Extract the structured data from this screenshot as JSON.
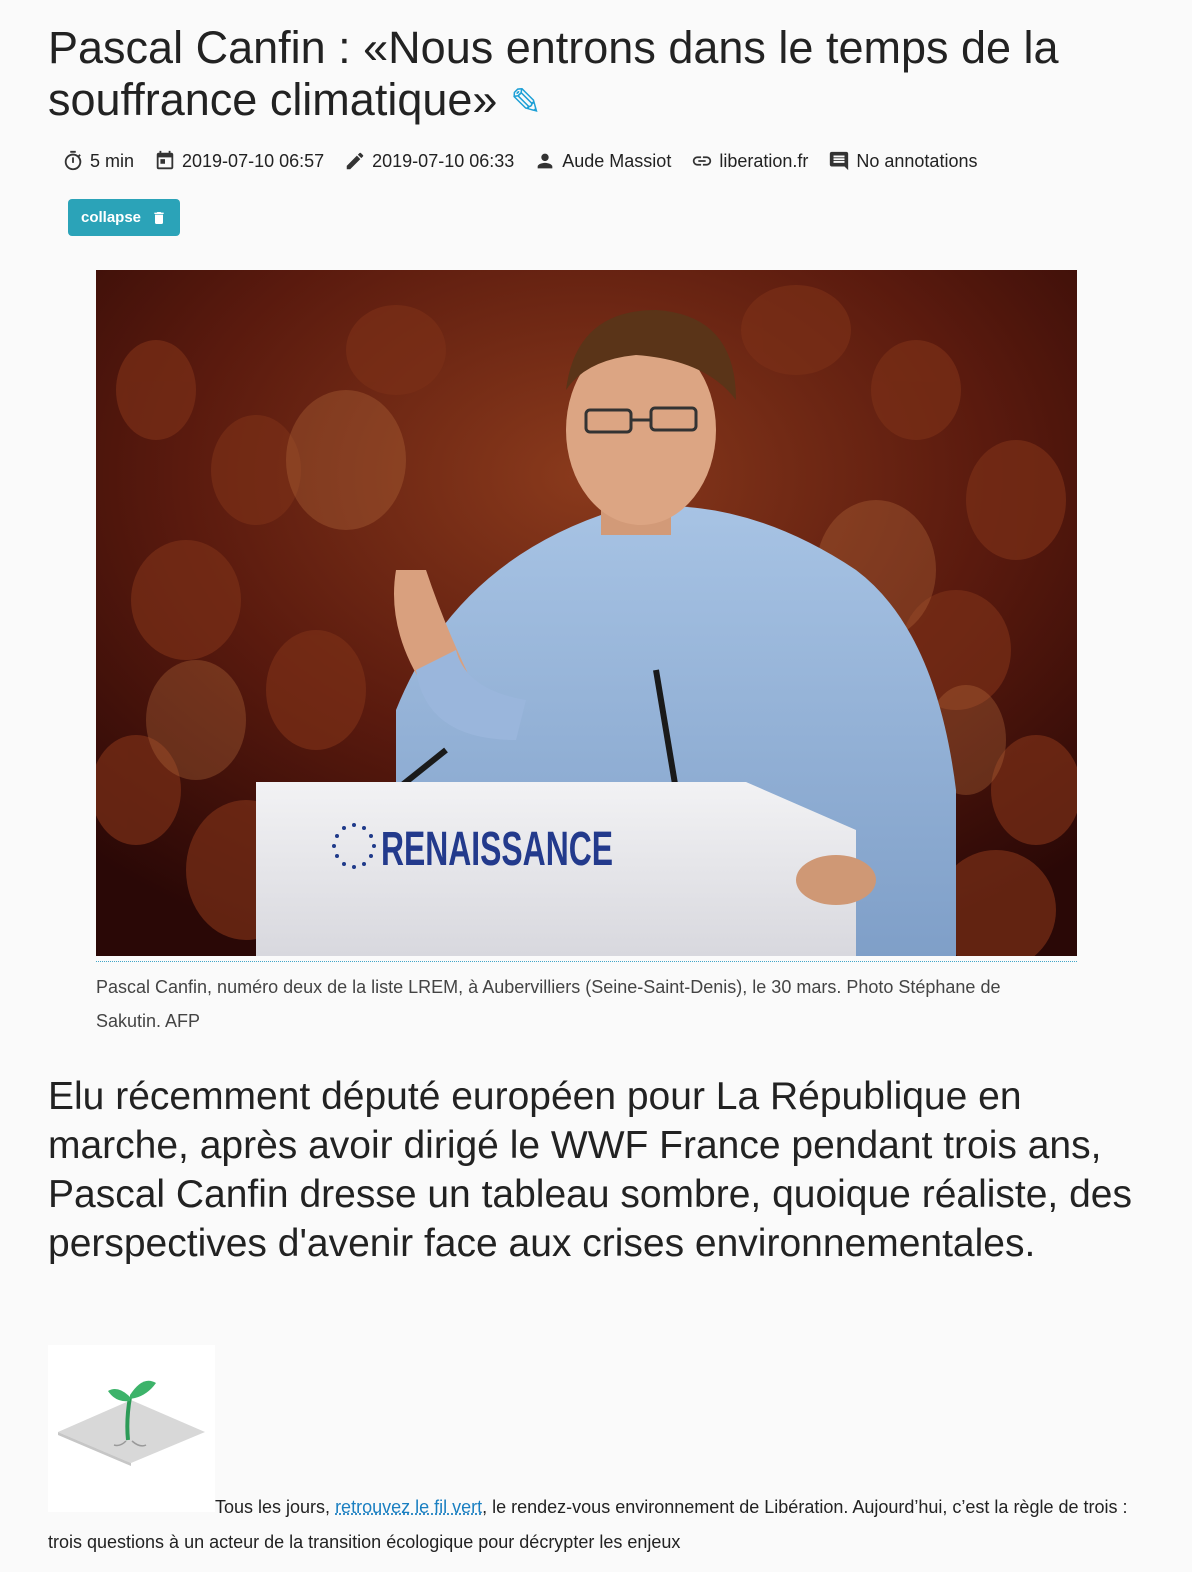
{
  "article": {
    "title": "Pascal Canfin : «Nous entrons dans le temps de la souffrance climatique»",
    "title_icon": "pencil-icon"
  },
  "meta": {
    "read_time": "5 min",
    "date_published": "2019-07-10 06:57",
    "date_edited": "2019-07-10 06:33",
    "author": "Aude Massiot",
    "source": "liberation.fr",
    "annotations": "No annotations"
  },
  "actions": {
    "collapse_label": "collapse"
  },
  "photo": {
    "podium_text": "RENAISSANCE",
    "caption": "Pascal Canfin, numéro deux de la liste LREM, à Aubervilliers (Seine-Saint-Denis), le 30 mars. Photo Stéphane de Sakutin. AFP"
  },
  "lede": "Elu récemment député européen pour La République en marche, après avoir dirigé le WWF France pendant trois ans, Pascal Canfin dresse un tableau sombre, quoique réaliste, des perspectives d'avenir face aux crises environnementales.",
  "body": {
    "intro_before_link": "Tous les jours, ",
    "link_text": "retrouvez le fil vert",
    "intro_after_link": ", le rendez-vous environnement de Libération. Aujourd’hui, c’est la règle de trois : trois questions à un acteur de la transition écologique pour décrypter les enjeux"
  },
  "colors": {
    "accent": "#2ba3b8",
    "link": "#1a7fc1",
    "pencil": "#1ea0d6"
  }
}
